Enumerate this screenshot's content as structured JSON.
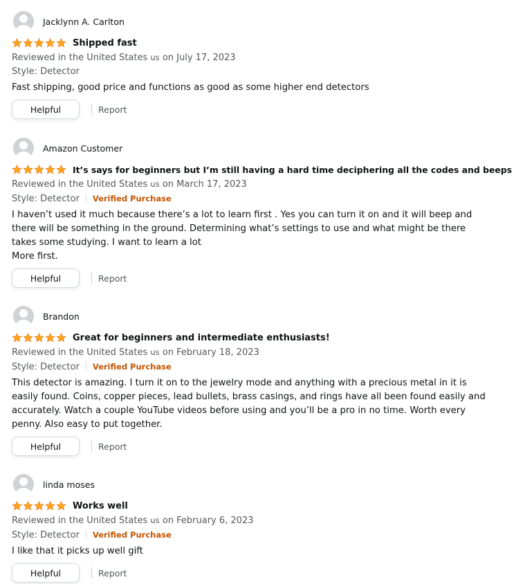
{
  "reviews": [
    {
      "name": "Jacklynn A. Carlton",
      "rating": 5,
      "title": "Shipped fast",
      "meta_prefix": "Reviewed in the United States",
      "meta_us": "us",
      "meta_suffix": "on July 17, 2023",
      "style": "Style: Detector",
      "verified": "",
      "body": "Fast shipping, good price and functions as good as some higher end detectors",
      "helpful": "Helpful",
      "report": "Report"
    },
    {
      "name": "Amazon Customer",
      "rating": 5,
      "title": "It’s says for beginners but I’m still having a hard time deciphering all the codes and beeps",
      "meta_prefix": "Reviewed in the United States",
      "meta_us": "us",
      "meta_suffix": "on March 17, 2023",
      "style": "Style: Detector",
      "verified": "Verified Purchase",
      "body": "I haven’t used it much because there’s a lot to learn first . Yes you can turn it on and it will beep and there will be something in the ground. Determining what’s settings to use and what might be there takes some studying. I want to learn a lot\nMore first.",
      "helpful": "Helpful",
      "report": "Report"
    },
    {
      "name": "Brandon",
      "rating": 5,
      "title": "Great for beginners and intermediate enthusiasts!",
      "meta_prefix": "Reviewed in the United States",
      "meta_us": "us",
      "meta_suffix": "on February 18, 2023",
      "style": "Style: Detector",
      "verified": "Verified Purchase",
      "body": "This detector is amazing. I turn it on to the jewelry mode and anything with a precious metal in it is easily found. Coins, copper pieces, lead bullets, brass casings, and rings have all been found easily and accurately. Watch a couple YouTube videos before using and you’ll be a pro in no time. Worth every penny. Also easy to put together.",
      "helpful": "Helpful",
      "report": "Report"
    },
    {
      "name": "linda moses",
      "rating": 5,
      "title": "Works well",
      "meta_prefix": "Reviewed in the United States",
      "meta_us": "us",
      "meta_suffix": "on February 6, 2023",
      "style": "Style: Detector",
      "verified": "Verified Purchase",
      "body": "I like that it picks up well gift",
      "helpful": "Helpful",
      "report": "Report"
    }
  ],
  "colors": {
    "star": "#ffa41c",
    "verified": "#c45500",
    "muted": "#565959"
  }
}
